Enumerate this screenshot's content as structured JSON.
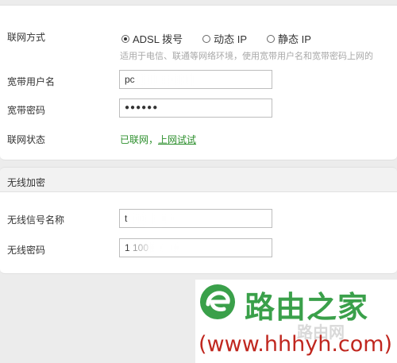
{
  "network": {
    "connection_mode_label": "联网方式",
    "modes": [
      {
        "label": "ADSL 拨号",
        "checked": true
      },
      {
        "label": "动态 IP",
        "checked": false
      },
      {
        "label": "静态 IP",
        "checked": false
      }
    ],
    "hint": "适用于电信、联通等网络环境，使用宽带用户名和宽带密码上网的",
    "username_label": "宽带用户名",
    "username_value": "pc",
    "password_label": "宽带密码",
    "password_value": "●●●●●●",
    "status_label": "联网状态",
    "status_text": "已联网，",
    "status_link": "上网试试"
  },
  "wireless": {
    "section_title": "无线加密",
    "ssid_label": "无线信号名称",
    "ssid_value": "t",
    "password_label": "无线密码",
    "password_value": "1         100"
  },
  "watermark": {
    "title": "路由之家",
    "subtitle": "路由网",
    "url": "(www.hhhyh.com)"
  },
  "colors": {
    "status_green": "#2d8f2d",
    "watermark_green": "#3aa04a",
    "watermark_red": "#c0271f"
  }
}
